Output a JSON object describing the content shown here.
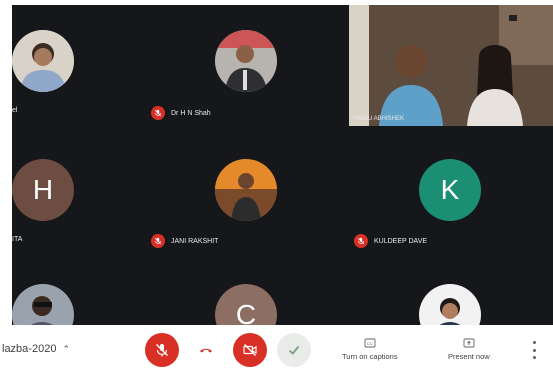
{
  "participants": [
    {
      "name": "el",
      "muted": false,
      "avatar": {
        "type": "photo",
        "icon": "person-photo"
      }
    },
    {
      "name": "Dr H N Shah",
      "muted": true,
      "avatar": {
        "type": "photo",
        "icon": "person-photo"
      }
    },
    {
      "name": "ITA",
      "muted": false,
      "avatar": {
        "type": "letter",
        "letter": "H",
        "color": "#6d4c41"
      }
    },
    {
      "name": "JANI RAKSHIT",
      "muted": true,
      "avatar": {
        "type": "photo",
        "icon": "person-photo"
      }
    },
    {
      "name": "KULDEEP DAVE",
      "muted": true,
      "avatar": {
        "type": "letter",
        "letter": "K",
        "color": "#1a8f73"
      }
    },
    {
      "name": "",
      "muted": false,
      "avatar": {
        "type": "photo",
        "icon": "person-photo"
      }
    },
    {
      "name": "",
      "muted": false,
      "avatar": {
        "type": "letter",
        "letter": "C",
        "color": "#8d6e63"
      }
    },
    {
      "name": "",
      "muted": false,
      "avatar": {
        "type": "photo",
        "icon": "person-photo"
      }
    }
  ],
  "video_tile": {
    "label": "HINGU ABHISHEK",
    "icon": "video-feed"
  },
  "bottom_bar": {
    "meeting_code": "lazba-2020",
    "buttons": {
      "mic": {
        "icon": "mic-off-icon",
        "color": "#d93025"
      },
      "hangup": {
        "icon": "hangup-icon",
        "color": "#d93025"
      },
      "camera": {
        "icon": "camera-off-icon",
        "color": "#d93025"
      },
      "confirm": {
        "icon": "check-icon",
        "color": "#9aa69a"
      }
    },
    "captions_label": "Turn on captions",
    "present_label": "Present now"
  },
  "colors": {
    "background": "#15171a",
    "accent_red": "#d93025"
  }
}
